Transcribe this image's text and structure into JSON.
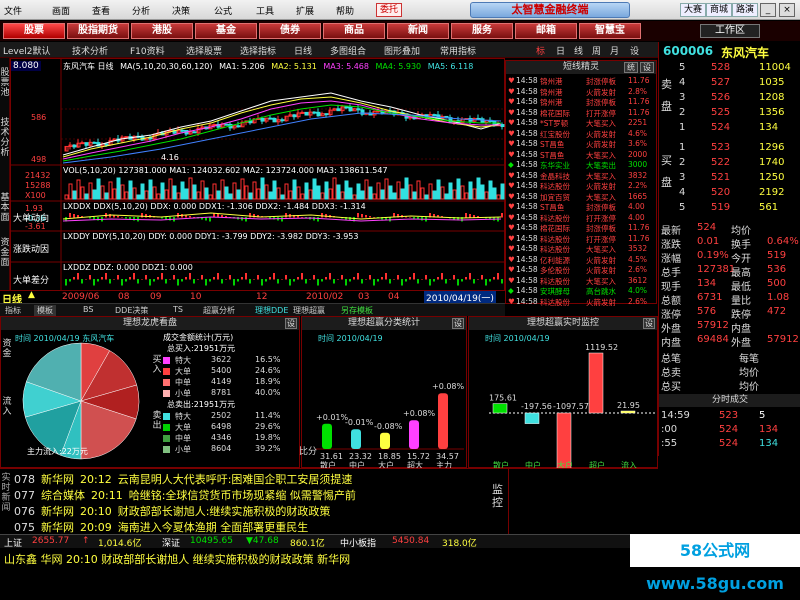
{
  "menubar": {
    "items": [
      "文件",
      "画面",
      "查看",
      "分析",
      "决策",
      "公式",
      "工具",
      "扩展",
      "帮助"
    ],
    "weituo": "委托",
    "brand": "太智慧金融终端",
    "links": [
      "大赛",
      "商城",
      "路演"
    ]
  },
  "navbar": {
    "items": [
      "股票",
      "股指期货",
      "港股",
      "基金",
      "债券",
      "商品",
      "新闻",
      "服务",
      "邮箱",
      "智慧宝"
    ],
    "workzone": "工作区"
  },
  "toolbar": {
    "items": [
      "Level2默认",
      "技术分析",
      "F10资料",
      "选择股票",
      "选择指标",
      "日线",
      "多图组合",
      "图形叠加",
      "常用指标"
    ],
    "icons": [
      "标",
      "日",
      "线",
      "周",
      "月",
      "设"
    ]
  },
  "chart": {
    "price_label": "8.080",
    "title": "东风汽车 日线",
    "ma_header": "MA(5,10,20,30,60,120)",
    "ma_values": [
      "MA1: 5.206",
      "MA2: 5.131",
      "MA3: 5.468",
      "MA4: 5.930",
      "MA5: 6.118"
    ],
    "y_ticks": [
      "586",
      "498"
    ],
    "low_label": "4.16",
    "vol_header": "VOL(5,10,20)  127381.000  MA1: 124032.602  MA2: 123724.000  MA3: 138611.547",
    "vol_y": [
      "21432",
      "15288",
      "X100"
    ],
    "ddx_header": "LXDDX DDX(5,10,20)  DDX: 0.000  DDX1: -1.306  DDX2: -1.484  DDX3: -1.314",
    "ddx_y": [
      "1.93",
      "-0.36",
      "-3.61"
    ],
    "ddx_label": "大单动向",
    "ddy_header": "LXDDY DDY(5,10,20)  DDY: 0.000  DDY1: -3.799  DDY2: -3.982  DDY3: -3.953",
    "ddy_label": "涨跌动因",
    "ddz_header": "LXDDZ DDZ: 0.000  DDZ1: 0.000",
    "ddz_label": "大单差分",
    "left_vlabels": [
      "股票池",
      "技术分析",
      "基本面",
      "资金面",
      "分析"
    ],
    "timebar_label": "日线",
    "time_ticks": [
      "2009/06",
      "08",
      "09",
      "10",
      "12",
      "2010/02",
      "03",
      "04",
      "2010/04/19(一)"
    ],
    "tabs": [
      "指标",
      "模板",
      "BS",
      "DDE决策",
      "TS",
      "超赢分析",
      "理想DDE",
      "理想超赢",
      "另存模板"
    ]
  },
  "spirit": {
    "title": "短线精灵",
    "buttons": [
      "统",
      "设"
    ],
    "rows": [
      {
        "t": "14:58",
        "name": "锦州港",
        "sig": "封涨停板",
        "val": "11.76",
        "c": "red"
      },
      {
        "t": "14:58",
        "name": "锦州港",
        "sig": "火箭发射",
        "val": "2.8%",
        "c": "red"
      },
      {
        "t": "14:58",
        "name": "锦州港",
        "sig": "封涨停板",
        "val": "11.76",
        "c": "red"
      },
      {
        "t": "14:58",
        "name": "棉花国际",
        "sig": "打开涨停",
        "val": "11.76",
        "c": "red"
      },
      {
        "t": "14:58",
        "name": "*ST罗顿",
        "sig": "大笔买入",
        "val": "2251",
        "c": "red"
      },
      {
        "t": "14:58",
        "name": "红宝股份",
        "sig": "火箭发射",
        "val": "4.6%",
        "c": "red"
      },
      {
        "t": "14:58",
        "name": "ST昌鱼",
        "sig": "火箭发射",
        "val": "3.6%",
        "c": "red"
      },
      {
        "t": "14:58",
        "name": "ST昌鱼",
        "sig": "大笔买入",
        "val": "2000",
        "c": "red"
      },
      {
        "t": "14:58",
        "name": "东华实业",
        "sig": "大笔卖出",
        "val": "3000",
        "c": "green"
      },
      {
        "t": "14:58",
        "name": "金晶科技",
        "sig": "大笔买入",
        "val": "3832",
        "c": "red"
      },
      {
        "t": "14:58",
        "name": "科达股份",
        "sig": "火箭发射",
        "val": "2.2%",
        "c": "red"
      },
      {
        "t": "14:58",
        "name": "加宜百贸",
        "sig": "大笔买入",
        "val": "1665",
        "c": "red"
      },
      {
        "t": "14:58",
        "name": "ST昌鱼",
        "sig": "封涨停板",
        "val": "4.00",
        "c": "red"
      },
      {
        "t": "14:58",
        "name": "科达股份",
        "sig": "打开涨停",
        "val": "4.00",
        "c": "red"
      },
      {
        "t": "14:58",
        "name": "棉花国际",
        "sig": "封涨停板",
        "val": "11.76",
        "c": "red"
      },
      {
        "t": "14:58",
        "name": "科达股份",
        "sig": "打开涨停",
        "val": "11.76",
        "c": "red"
      },
      {
        "t": "14:58",
        "name": "科达股份",
        "sig": "大笔买入",
        "val": "3532",
        "c": "red"
      },
      {
        "t": "14:58",
        "name": "亿利能源",
        "sig": "火箭发射",
        "val": "4.5%",
        "c": "red"
      },
      {
        "t": "14:58",
        "name": "多伦股份",
        "sig": "火箭发射",
        "val": "2.6%",
        "c": "red"
      },
      {
        "t": "14:58",
        "name": "科达股份",
        "sig": "大笔买入",
        "val": "3612",
        "c": "red"
      },
      {
        "t": "14:58",
        "name": "安琪酵母",
        "sig": "高台跳水",
        "val": "4.0%",
        "c": "green"
      },
      {
        "t": "14:58",
        "name": "科达股份",
        "sig": "火箭发射",
        "val": "2.6%",
        "c": "red"
      }
    ]
  },
  "quote": {
    "code": "600006",
    "name": "东风汽车",
    "sell_label": "卖盘",
    "buy_label": "买盘",
    "sells": [
      {
        "lv": "5",
        "price": "528",
        "vol": "11004"
      },
      {
        "lv": "4",
        "price": "527",
        "vol": "1035"
      },
      {
        "lv": "3",
        "price": "526",
        "vol": "1208"
      },
      {
        "lv": "2",
        "price": "525",
        "vol": "1356"
      },
      {
        "lv": "1",
        "price": "524",
        "vol": "134"
      }
    ],
    "buys": [
      {
        "lv": "1",
        "price": "523",
        "vol": "1296"
      },
      {
        "lv": "2",
        "price": "522",
        "vol": "1740"
      },
      {
        "lv": "3",
        "price": "521",
        "vol": "1250"
      },
      {
        "lv": "4",
        "price": "520",
        "vol": "2192"
      },
      {
        "lv": "5",
        "price": "519",
        "vol": "561"
      }
    ],
    "stats": [
      {
        "a": "最新",
        "b": "524",
        "c": "均价",
        "d": ""
      },
      {
        "a": "涨跌",
        "b": "0.01",
        "c": "换手",
        "d": "0.64%"
      },
      {
        "a": "涨幅",
        "b": "0.19%",
        "c": "今开",
        "d": "519"
      },
      {
        "a": "总手",
        "b": "127381",
        "c": "最高",
        "d": "536"
      },
      {
        "a": "现手",
        "b": "134",
        "c": "最低",
        "d": "500"
      },
      {
        "a": "总额",
        "b": "6731",
        "c": "量比",
        "d": "1.08"
      },
      {
        "a": "涨停",
        "b": "576",
        "c": "跌停",
        "d": "472"
      },
      {
        "a": "外盘",
        "b": "57912",
        "c": "内盘",
        "d": ""
      },
      {
        "a": "内盘",
        "b": "69484",
        "c": "外盘",
        "d": "57912"
      }
    ],
    "extra": [
      "总笔",
      "每笔",
      "总卖",
      "均价",
      "总买",
      "均价"
    ],
    "fenshi_title": "分时成交",
    "trades": [
      {
        "t": "14:59",
        "p": "523",
        "v": "5",
        "c": "white"
      },
      {
        "t": ":00",
        "p": "524",
        "v": "134",
        "c": "red"
      },
      {
        "t": ":55",
        "p": "524",
        "v": "134",
        "c": "cyan"
      }
    ]
  },
  "bottom": {
    "panel1_title": "理想龙虎看盘",
    "panel1_date": "时间 2010/04/19  东风汽车",
    "pie_label": "主力流入:22万元",
    "panel1_left_labels": [
      "资金",
      "流入"
    ],
    "deal_title": "成交金额统计(万元)",
    "buy_total": "总买入:21951万元",
    "sell_total": "总卖出:21951万元",
    "buy_side": "买入",
    "sell_side": "卖出",
    "buy_rows": [
      {
        "k": "特大",
        "v": "3622",
        "p": "16.5%",
        "c": "#ff40ff"
      },
      {
        "k": "大单",
        "v": "5400",
        "p": "24.6%",
        "c": "#ff4040"
      },
      {
        "k": "中单",
        "v": "4149",
        "p": "18.9%",
        "c": "#ff7070"
      },
      {
        "k": "小单",
        "v": "8781",
        "p": "40.0%",
        "c": "#ffb0b0"
      }
    ],
    "sell_rows": [
      {
        "k": "特大",
        "v": "2502",
        "p": "11.4%",
        "c": "#40e0e0"
      },
      {
        "k": "大单",
        "v": "6498",
        "p": "29.6%",
        "c": "#00d000"
      },
      {
        "k": "中单",
        "v": "4346",
        "p": "19.8%",
        "c": "#40a040"
      },
      {
        "k": "小单",
        "v": "8604",
        "p": "39.2%",
        "c": "#80c080"
      }
    ],
    "panel2_title": "理想超赢分类统计",
    "panel2_date": "时间 2010/04/19",
    "panel2_left": [
      "比",
      "分",
      "类"
    ],
    "panel2_side": "比分",
    "bars2": [
      {
        "cat": "散户",
        "val": "31.61",
        "pct": "+0.01%",
        "color": "#00e000",
        "h": 0.28
      },
      {
        "cat": "中户",
        "val": "23.32",
        "pct": "-0.01%",
        "color": "#40e0e0",
        "h": 0.22
      },
      {
        "cat": "大户",
        "val": "18.85",
        "pct": "-0.08%",
        "color": "#ffff40",
        "h": 0.18
      },
      {
        "cat": "超大",
        "val": "15.72",
        "pct": "+0.08%",
        "color": "#ff40ff",
        "h": 0.32
      },
      {
        "cat": "主力",
        "val": "34.57",
        "pct": "+0.08%",
        "color": "#ff4040",
        "h": 0.62
      }
    ],
    "panel3_title": "理想超赢实时监控",
    "panel3_date": "时间 2010/04/19",
    "bars3": [
      {
        "cat": "散户",
        "val": "175.61",
        "color": "#00e000"
      },
      {
        "cat": "中户",
        "val": "-197.56",
        "color": "#40e0e0"
      },
      {
        "cat": "大户",
        "val": "-1097.57",
        "color": "#ff4040"
      },
      {
        "cat": "超户",
        "val": "1119.52",
        "color": "#ff4040"
      },
      {
        "cat": "流入",
        "val": "21.95",
        "color": "#ffff40"
      }
    ],
    "set": "设"
  },
  "news": {
    "side_label": "实时新闻",
    "right_label": "监控",
    "rows": [
      {
        "n": "078",
        "src": "新华网",
        "time": "20:12",
        "txt": "云南昆明人大代表呼吁:困难国企职工安居须提速"
      },
      {
        "n": "077",
        "src": "综合媒体",
        "time": "20:11",
        "txt": "哈继铭:全球信贷货币市场现紧缩 似需警惕产前"
      },
      {
        "n": "076",
        "src": "新华网",
        "time": "20:10",
        "txt": "财政部部长谢旭人:继续实施积极的财政政策"
      },
      {
        "n": "075",
        "src": "新华网",
        "time": "20:09",
        "txt": "海南进入今夏体渔期 全面部署更重民生"
      }
    ]
  },
  "statusbar": {
    "items": [
      {
        "t": "上证",
        "c": "white"
      },
      {
        "t": "2655.77",
        "c": "red"
      },
      {
        "t": "↑",
        "c": "red"
      },
      {
        "t": "1,014.6亿",
        "c": "yellow"
      },
      {
        "t": "深证",
        "c": "white"
      },
      {
        "t": "10495.65",
        "c": "green"
      },
      {
        "t": "▼47.68",
        "c": "green"
      },
      {
        "t": "860.1亿",
        "c": "yellow"
      },
      {
        "t": "中小板指",
        "c": "white"
      },
      {
        "t": "5450.84",
        "c": "red"
      },
      {
        "t": "318.0亿",
        "c": "yellow"
      }
    ]
  },
  "ticker": "山东鑫   华网   20:10 财政部部长谢旭人  继续实施积极的财政政策  新华网",
  "watermark": "58公式网 www.58gu.com"
}
